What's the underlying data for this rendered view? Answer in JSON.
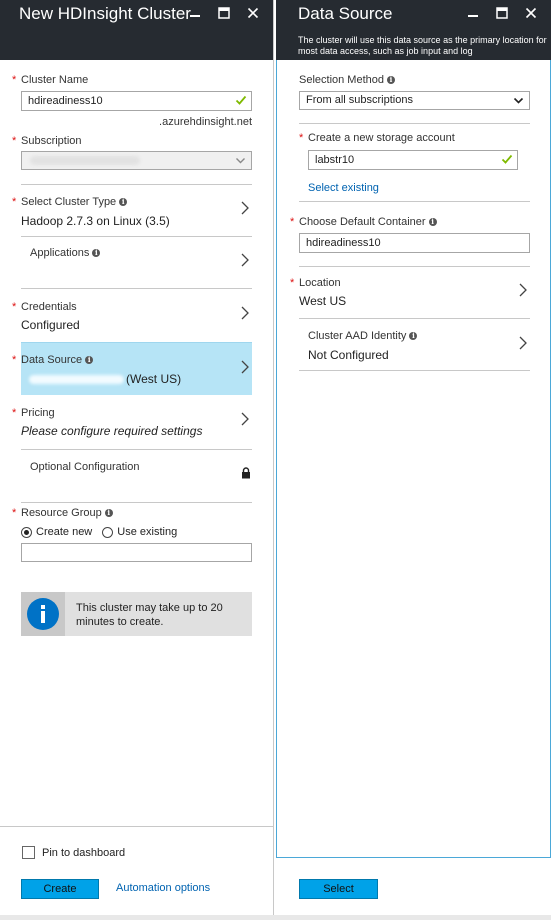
{
  "left_blade": {
    "title": "New HDInsight Cluster",
    "cluster_name": {
      "label": "Cluster Name",
      "value": "hdireadiness10",
      "suffix": ".azurehdinsight.net"
    },
    "subscription": {
      "label": "Subscription"
    },
    "cluster_type": {
      "label": "Select Cluster Type",
      "value": "Hadoop 2.7.3 on Linux (3.5)"
    },
    "applications": {
      "label": "Applications"
    },
    "credentials": {
      "label": "Credentials",
      "value": "Configured"
    },
    "data_source": {
      "label": "Data Source",
      "value": "(West US)"
    },
    "pricing": {
      "label": "Pricing",
      "value": "Please configure required settings"
    },
    "optional_configuration": {
      "label": "Optional Configuration"
    },
    "resource_group": {
      "label": "Resource Group",
      "option_new": "Create new",
      "option_existing": "Use existing",
      "selected": "Create new",
      "value": ""
    },
    "info_message": "This cluster may take up to 20 minutes to create.",
    "pin_label": "Pin to dashboard",
    "pin_checked": false,
    "create_button": "Create",
    "automation_link": "Automation options"
  },
  "right_blade": {
    "title": "Data Source",
    "subtitle": "The cluster will use this data source as the primary location for most data access, such as job input and log",
    "selection_method": {
      "label": "Selection Method",
      "value": "From all subscriptions"
    },
    "storage_account": {
      "label": "Create a new storage account",
      "value": "labstr10",
      "select_existing": "Select existing"
    },
    "default_container": {
      "label": "Choose Default Container",
      "value": "hdireadiness10"
    },
    "location": {
      "label": "Location",
      "value": "West US"
    },
    "aad_identity": {
      "label": "Cluster AAD Identity",
      "value": "Not Configured"
    },
    "select_button": "Select"
  },
  "colors": {
    "header_bg": "#262b31",
    "selected_row_bg": "#b6e4f6",
    "primary_button": "#00a2e8",
    "link": "#0063b1",
    "required": "#dd1111",
    "valid_check": "#7fba00"
  },
  "icons": [
    "minimize-icon",
    "maximize-icon",
    "close-icon",
    "info-icon",
    "checkmark-icon",
    "chevron-right-icon",
    "chevron-down-icon",
    "lock-icon",
    "info-circle-icon"
  ]
}
